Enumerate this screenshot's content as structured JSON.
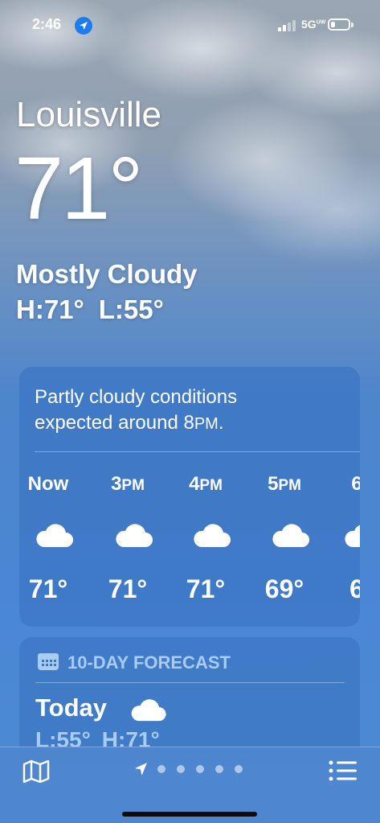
{
  "status_bar": {
    "time": "2:46",
    "network": "5G",
    "network_super": "UW",
    "battery_level": 0.25
  },
  "header": {
    "city": "Louisville",
    "temperature": "71°",
    "condition": "Mostly Cloudy",
    "high": "H:71°",
    "low": "L:55°"
  },
  "hourly": {
    "summary_line1": "Partly cloudy conditions",
    "summary_line2_prefix": "expected around 8",
    "summary_line2_suffix": "PM",
    "summary_line2_end": ".",
    "items": [
      {
        "label": "Now",
        "suffix": "",
        "temp": "71°",
        "icon": "cloud-icon"
      },
      {
        "label": "3",
        "suffix": "PM",
        "temp": "71°",
        "icon": "cloud-icon"
      },
      {
        "label": "4",
        "suffix": "PM",
        "temp": "71°",
        "icon": "cloud-icon"
      },
      {
        "label": "5",
        "suffix": "PM",
        "temp": "69°",
        "icon": "cloud-icon"
      },
      {
        "label": "6",
        "suffix": "",
        "temp": "6",
        "icon": "cloud-icon"
      }
    ]
  },
  "ten_day": {
    "title": "10-DAY FORECAST",
    "today_label": "Today",
    "today_low": "L:55°",
    "today_high": "H:71°"
  },
  "bottom_bar": {
    "page_count": 5,
    "icons": [
      "map-icon",
      "location-arrow-icon",
      "list-icon"
    ]
  },
  "colors": {
    "sky_top": "#9aa6b3",
    "sky_bottom": "#4d8bd6",
    "card_bg": "#3c76c4",
    "accent_light_blue": "#a9ccf5",
    "location_blue": "#1e7cf2"
  }
}
